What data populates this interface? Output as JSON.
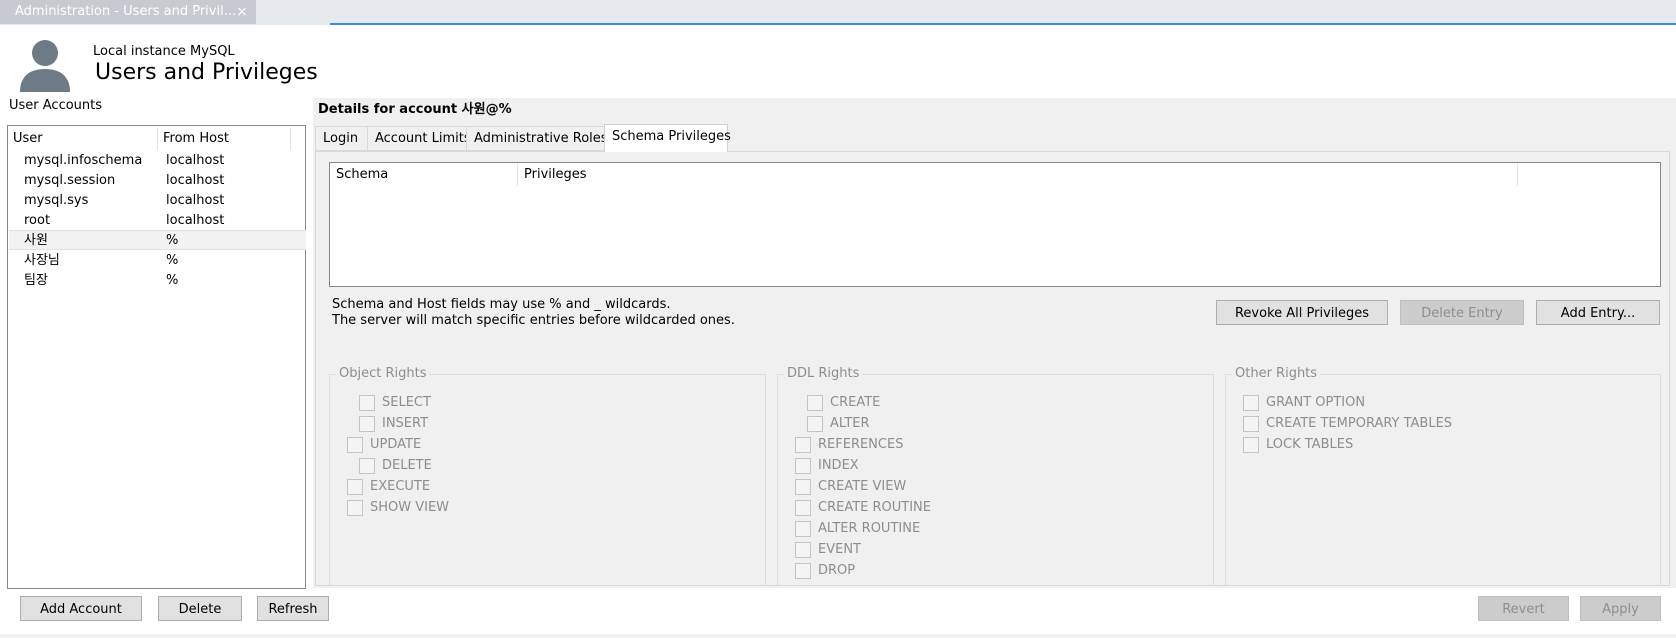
{
  "doc_tab": {
    "title": "Administration - Users and Privil...",
    "close": "×"
  },
  "header": {
    "subtitle": "Local instance MySQL",
    "title": "Users and Privileges"
  },
  "left": {
    "label": "User Accounts",
    "columns": {
      "user": "User",
      "host": "From Host"
    },
    "rows": [
      {
        "user": "mysql.infoschema",
        "host": "localhost"
      },
      {
        "user": "mysql.session",
        "host": "localhost"
      },
      {
        "user": "mysql.sys",
        "host": "localhost"
      },
      {
        "user": "root",
        "host": "localhost"
      },
      {
        "user": "사원",
        "host": "%"
      },
      {
        "user": "사장님",
        "host": "%"
      },
      {
        "user": "팀장",
        "host": "%"
      }
    ],
    "selected_user": "사원",
    "buttons": {
      "add": "Add Account",
      "delete": "Delete",
      "refresh": "Refresh"
    }
  },
  "details": {
    "title": "Details for account 사원@%",
    "tabs": [
      "Login",
      "Account Limits",
      "Administrative Roles",
      "Schema Privileges"
    ],
    "active_tab": "Schema Privileges",
    "table_columns": {
      "schema": "Schema",
      "privileges": "Privileges"
    },
    "hint_line1": "Schema and Host fields may use % and _ wildcards.",
    "hint_line2": "The server will match specific entries before wildcarded ones.",
    "buttons": {
      "revoke_all": "Revoke All Privileges",
      "delete_entry": "Delete Entry",
      "add_entry": "Add Entry..."
    },
    "groups": {
      "object": {
        "label": "Object Rights",
        "items": [
          "SELECT",
          "INSERT",
          "UPDATE",
          "DELETE",
          "EXECUTE",
          "SHOW VIEW"
        ]
      },
      "ddl": {
        "label": "DDL Rights",
        "items": [
          "CREATE",
          "ALTER",
          "REFERENCES",
          "INDEX",
          "CREATE VIEW",
          "CREATE ROUTINE",
          "ALTER ROUTINE",
          "EVENT",
          "DROP"
        ]
      },
      "other": {
        "label": "Other Rights",
        "items": [
          "GRANT OPTION",
          "CREATE TEMPORARY TABLES",
          "LOCK TABLES"
        ]
      }
    }
  },
  "footer": {
    "revert": "Revert",
    "apply": "Apply"
  },
  "colors": {
    "accent": "#3c8fd6",
    "panel_bg": "#f0f0f0",
    "disabled_text": "#8d8d8d"
  }
}
